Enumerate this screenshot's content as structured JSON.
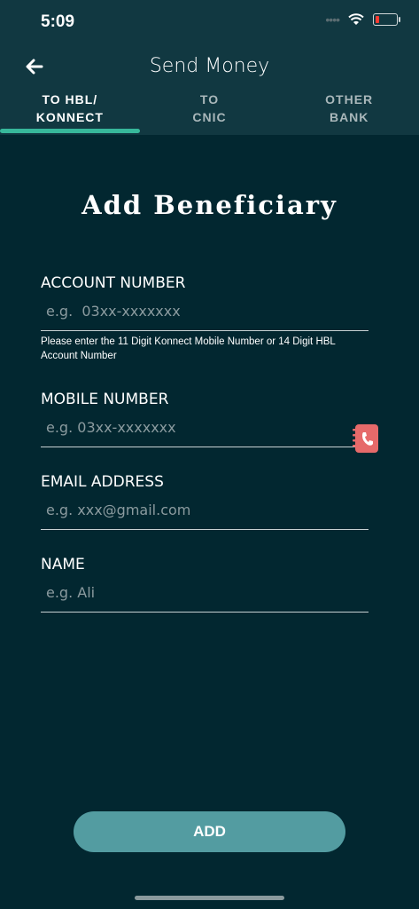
{
  "status": {
    "time": "5:09"
  },
  "header": {
    "title": "Send Money",
    "tabs": [
      {
        "line1": "TO HBL/",
        "line2": "KONNECT"
      },
      {
        "line1": "TO",
        "line2": "CNIC"
      },
      {
        "line1": "OTHER",
        "line2": "BANK"
      }
    ]
  },
  "form": {
    "heading": "Add Beneficiary",
    "account": {
      "label": "ACCOUNT NUMBER",
      "placeholder": "e.g.  03xx-xxxxxxx",
      "hint": "Please enter the 11 Digit Konnect Mobile Number or 14 Digit HBL Account Number"
    },
    "mobile": {
      "label": "MOBILE NUMBER",
      "placeholder": "e.g. 03xx-xxxxxxx"
    },
    "email": {
      "label": "EMAIL ADDRESS",
      "placeholder": "e.g. xxx@gmail.com"
    },
    "name": {
      "label": "NAME",
      "placeholder": "e.g. Ali"
    },
    "submit_label": "ADD"
  }
}
